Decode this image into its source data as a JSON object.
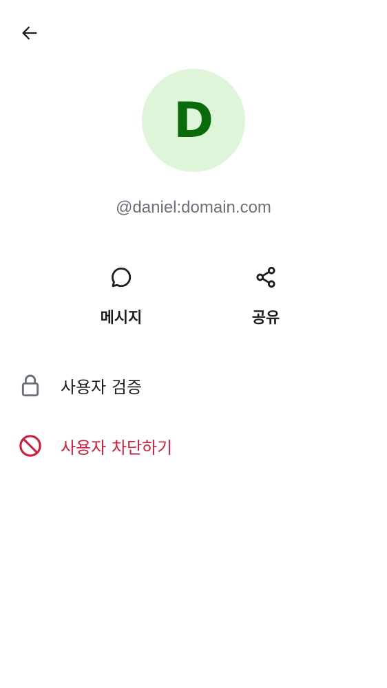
{
  "header": {
    "back_icon": "arrow-left-icon"
  },
  "profile": {
    "avatar_initial": "D",
    "avatar_bg_color": "#dff5da",
    "avatar_text_color": "#0a6b0a",
    "user_id": "@daniel:domain.com"
  },
  "actions": [
    {
      "label": "메시지",
      "icon": "chat-bubble-icon"
    },
    {
      "label": "공유",
      "icon": "share-icon"
    }
  ],
  "menu": [
    {
      "label": "사용자 검증",
      "icon": "lock-icon",
      "color": "#1b1d22"
    },
    {
      "label": "사용자 차단하기",
      "icon": "block-icon",
      "color": "#d21c3c"
    }
  ]
}
